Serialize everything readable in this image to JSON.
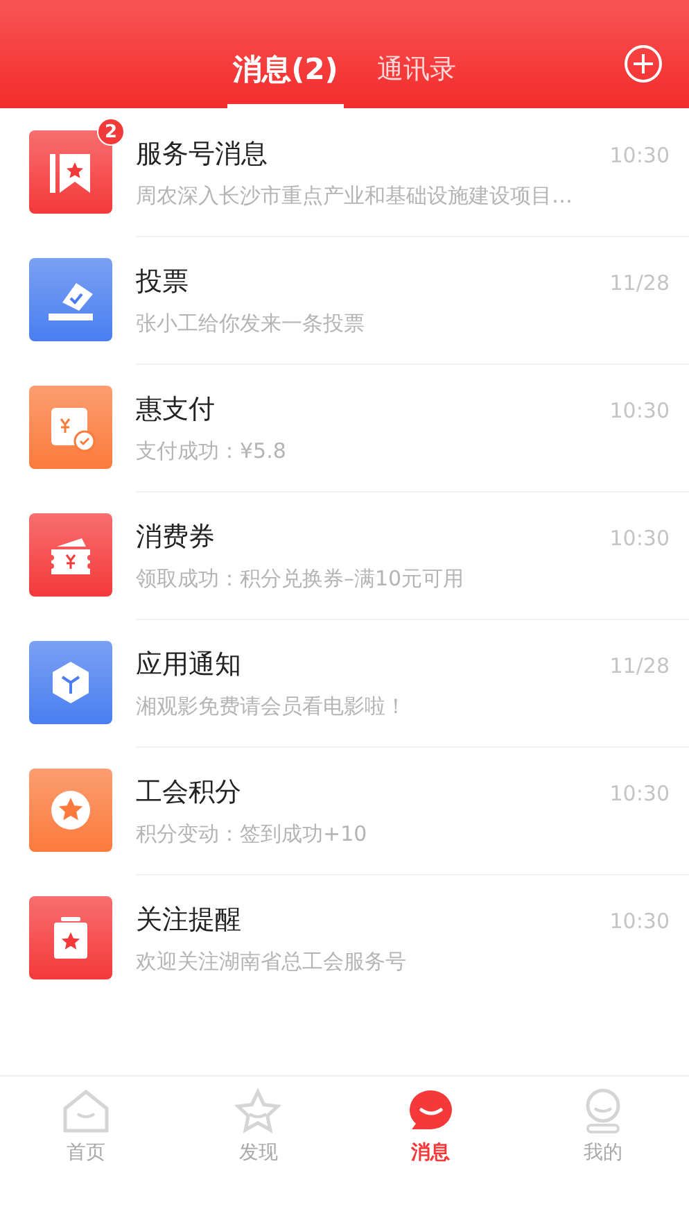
{
  "header": {
    "tabs": [
      {
        "label": "消息(2)",
        "selected": true
      },
      {
        "label": "通讯录",
        "selected": false
      }
    ]
  },
  "conversations": [
    {
      "kind": "bookmark",
      "color": "#f5393a",
      "badge": "2",
      "title": "服务号消息",
      "time": "10:30",
      "preview": "周农深入长沙市重点产业和基础设施建设项目…"
    },
    {
      "kind": "ballot",
      "color": "#4a7ef0",
      "title": "投票",
      "time": "11/28",
      "preview": "张小工给你发来一条投票"
    },
    {
      "kind": "payment",
      "color": "#fb7a3c",
      "title": "惠支付",
      "time": "10:30",
      "preview": "支付成功：¥5.8"
    },
    {
      "kind": "coupon",
      "color": "#f5393a",
      "title": "消费券",
      "time": "10:30",
      "preview": "领取成功：积分兑换券–满10元可用"
    },
    {
      "kind": "cube",
      "color": "#4a7ef0",
      "title": "应用通知",
      "time": "11/28",
      "preview": "湘观影免费请会员看电影啦！"
    },
    {
      "kind": "star",
      "color": "#fb7a3c",
      "title": "工会积分",
      "time": "10:30",
      "preview": "积分变动：签到成功+10"
    },
    {
      "kind": "clipboard",
      "color": "#f5393a",
      "title": "关注提醒",
      "time": "10:30",
      "preview": "欢迎关注湖南省总工会服务号"
    }
  ],
  "bottom_nav": [
    {
      "kind": "home",
      "label": "首页",
      "selected": false
    },
    {
      "kind": "discover",
      "label": "发现",
      "selected": false
    },
    {
      "kind": "messages",
      "label": "消息",
      "selected": true
    },
    {
      "kind": "me",
      "label": "我的",
      "selected": false
    }
  ]
}
